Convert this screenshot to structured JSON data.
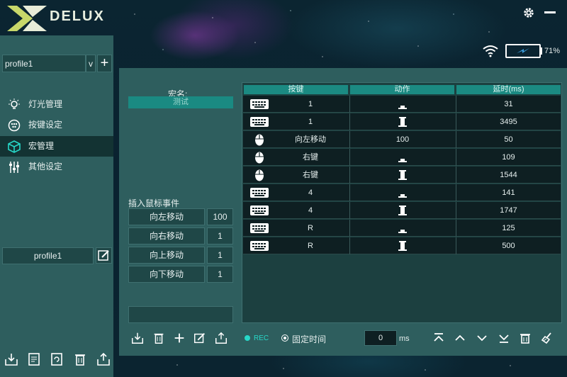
{
  "header": {
    "logo_text": "DELUX",
    "battery_percent": "71%",
    "battery_level": 0.71
  },
  "sidebar": {
    "profile_select_value": "profile1",
    "profile_caret": "v",
    "nav": [
      {
        "label": "灯光管理",
        "icon": "lightbulb-icon"
      },
      {
        "label": "按键设定",
        "icon": "buttons-icon"
      },
      {
        "label": "宏管理",
        "icon": "cube-icon"
      },
      {
        "label": "其他设定",
        "icon": "sliders-icon"
      }
    ],
    "active_index": 2,
    "profile_name": "profile1",
    "bottom_icons": [
      "import-icon",
      "document-icon",
      "refresh-icon",
      "trash-icon",
      "export-icon"
    ]
  },
  "macro": {
    "name_label": "宏名:",
    "name_value": "测试",
    "insert_label": "插入鼠标事件",
    "mouse_events": [
      {
        "label": "向左移动",
        "value": "100"
      },
      {
        "label": "向右移动",
        "value": "1"
      },
      {
        "label": "向上移动",
        "value": "1"
      },
      {
        "label": "向下移动",
        "value": "1"
      }
    ],
    "tool_icons": [
      "import-icon",
      "trash-icon",
      "plus-icon",
      "edit-icon",
      "export-icon"
    ]
  },
  "table": {
    "headers": [
      "按键",
      "动作",
      "延时(ms)"
    ],
    "rows": [
      {
        "type": "keyboard",
        "key": "1",
        "action": "press",
        "action_text": "",
        "delay": "31"
      },
      {
        "type": "keyboard",
        "key": "1",
        "action": "release",
        "action_text": "",
        "delay": "3495"
      },
      {
        "type": "mouse",
        "key": "向左移动",
        "action": "text",
        "action_text": "100",
        "delay": "50"
      },
      {
        "type": "mouse",
        "key": "右键",
        "action": "press",
        "action_text": "",
        "delay": "109"
      },
      {
        "type": "mouse",
        "key": "右键",
        "action": "release",
        "action_text": "",
        "delay": "1544"
      },
      {
        "type": "keyboard",
        "key": "4",
        "action": "press",
        "action_text": "",
        "delay": "141"
      },
      {
        "type": "keyboard",
        "key": "4",
        "action": "release",
        "action_text": "",
        "delay": "1747"
      },
      {
        "type": "keyboard",
        "key": "R",
        "action": "press",
        "action_text": "",
        "delay": "125"
      },
      {
        "type": "keyboard",
        "key": "R",
        "action": "release",
        "action_text": "",
        "delay": "500"
      }
    ]
  },
  "recorder": {
    "rec_label": "REC",
    "fixed_time_label": "固定时间",
    "delay_value": "0",
    "unit": "ms",
    "icons": [
      "move-top-icon",
      "move-up-icon",
      "move-down-icon",
      "move-bottom-icon",
      "trash-icon",
      "clear-icon"
    ]
  },
  "colors": {
    "accent": "#1b8a82",
    "rec": "#27d8c8",
    "panel": "#2e5e5e"
  }
}
